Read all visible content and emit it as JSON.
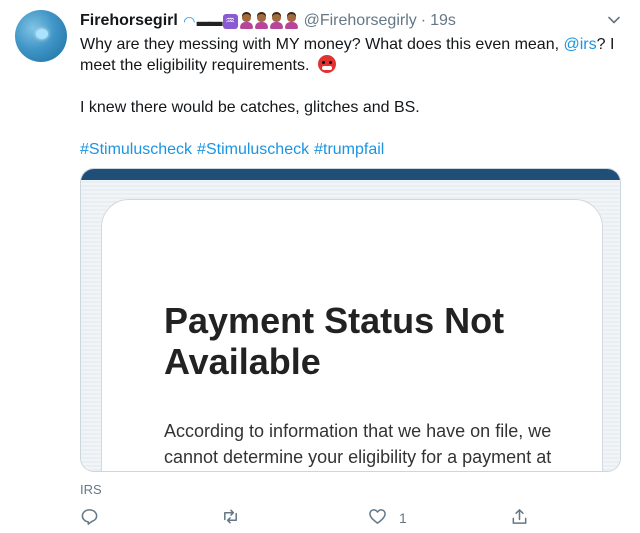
{
  "tweet": {
    "display_name": "Firehorsegirl",
    "name_emojis": [
      "wave-emoji",
      "sunglasses-emoji",
      "aquarius-emoji",
      "person-emoji",
      "person-emoji",
      "person-emoji",
      "person-emoji"
    ],
    "handle": "@Firehorsegirly",
    "dot": "·",
    "time": "19s",
    "text_part1": "Why are they messing with MY money? What does this even mean, ",
    "mention": "@irs",
    "text_part2": "? I meet the eligibility requirements. ",
    "text_line2": "I knew there would be catches, glitches and BS.",
    "hashtags": [
      "#Stimuluscheck",
      "#Stimuluscheck",
      "#trumpfail"
    ],
    "source": "IRS",
    "like_count": "1"
  },
  "media": {
    "title": "Payment Status Not Available",
    "body": "According to information that we have on file, we cannot determine your eligibility for a payment at this time."
  },
  "colors": {
    "link": "#1b95e0",
    "muted": "#657786",
    "irs_header": "#1f4f79"
  }
}
